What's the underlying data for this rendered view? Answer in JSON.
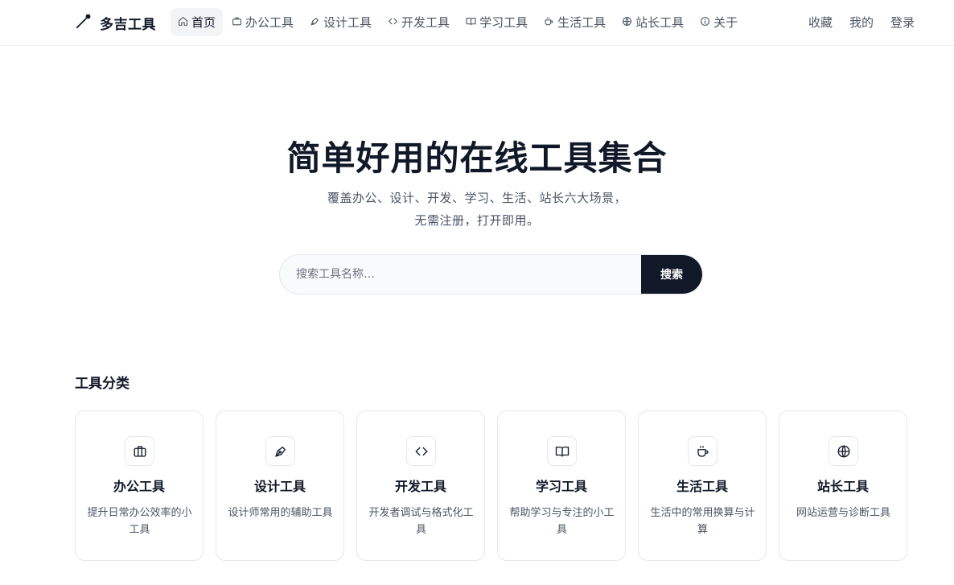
{
  "brand": {
    "name": "多吉工具",
    "icon": "wand-icon"
  },
  "nav": {
    "items": [
      {
        "label": "首页",
        "icon": "home-icon",
        "active": true
      },
      {
        "label": "办公工具",
        "icon": "briefcase-icon"
      },
      {
        "label": "设计工具",
        "icon": "pen-icon"
      },
      {
        "label": "开发工具",
        "icon": "code-icon"
      },
      {
        "label": "学习工具",
        "icon": "book-icon"
      },
      {
        "label": "生活工具",
        "icon": "coffee-icon"
      },
      {
        "label": "站长工具",
        "icon": "globe-icon"
      },
      {
        "label": "关于",
        "icon": "info-icon"
      }
    ],
    "right": {
      "favorites": "收藏",
      "mine": "我的",
      "login": "登录"
    }
  },
  "hero": {
    "title": "简单好用的在线工具集合",
    "subtitle_line1": "覆盖办公、设计、开发、学习、生活、站长六大场景，",
    "subtitle_line2": "无需注册，打开即用。"
  },
  "search": {
    "placeholder": "搜索工具名称…",
    "value": "",
    "button": "搜索"
  },
  "categories": {
    "title": "工具分类",
    "cards": [
      {
        "title": "办公工具",
        "desc": "提升日常办公效率的小工具",
        "icon": "briefcase-icon"
      },
      {
        "title": "设计工具",
        "desc": "设计师常用的辅助工具",
        "icon": "pen-icon"
      },
      {
        "title": "开发工具",
        "desc": "开发者调试与格式化工具",
        "icon": "code-icon"
      },
      {
        "title": "学习工具",
        "desc": "帮助学习与专注的小工具",
        "icon": "book-icon"
      },
      {
        "title": "生活工具",
        "desc": "生活中的常用换算与计算",
        "icon": "coffee-icon"
      },
      {
        "title": "站长工具",
        "desc": "网站运营与诊断工具",
        "icon": "globe-icon"
      }
    ]
  },
  "colors": {
    "primary": "#111827",
    "text_muted": "#4b5563",
    "border": "#e5e7eb",
    "active_bg": "#f3f4f6"
  }
}
